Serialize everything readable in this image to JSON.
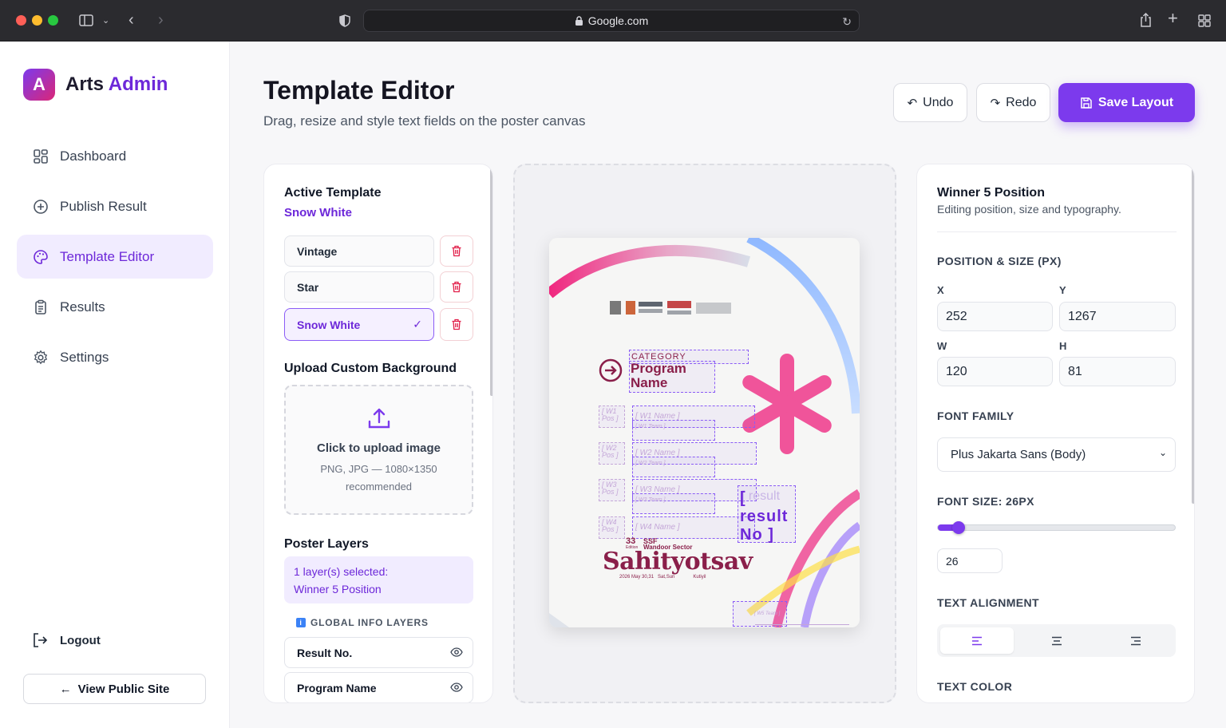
{
  "browser": {
    "url": "Google.com"
  },
  "sidebar": {
    "brand_letter": "A",
    "brand_first": "Arts",
    "brand_second": "Admin",
    "items": [
      {
        "label": "Dashboard",
        "icon": "dashboard-icon"
      },
      {
        "label": "Publish Result",
        "icon": "plus-circle-icon"
      },
      {
        "label": "Template Editor",
        "icon": "palette-icon",
        "active": true
      },
      {
        "label": "Results",
        "icon": "clipboard-icon"
      },
      {
        "label": "Settings",
        "icon": "gear-icon"
      }
    ],
    "logout": "Logout",
    "view_public": "View Public Site"
  },
  "header": {
    "title": "Template Editor",
    "subtitle": "Drag, resize and style text fields on the poster canvas",
    "undo": "Undo",
    "redo": "Redo",
    "save": "Save Layout"
  },
  "left_panel": {
    "active_template_heading": "Active Template",
    "active_template_name": "Snow White",
    "templates": [
      "Vintage",
      "Star",
      "Snow White"
    ],
    "upload_heading": "Upload Custom Background",
    "upload_title": "Click to upload image",
    "upload_hint": "PNG, JPG — 1080×1350 recommended",
    "layers_heading": "Poster Layers",
    "selection_line1": "1 layer(s) selected:",
    "selection_line2": "Winner 5 Position",
    "global_heading": "GLOBAL INFO LAYERS",
    "layers": [
      "Result No.",
      "Program Name"
    ]
  },
  "poster": {
    "category": "CATEGORY",
    "program_line1": "Program",
    "program_line2": "Name",
    "winners": [
      {
        "pos": "[ W1 Pos ]",
        "name": "[ W1 Name ]",
        "team": "[ W1 Team ]"
      },
      {
        "pos": "[ W2 Pos ]",
        "name": "[ W2 Name ]",
        "team": "[ W2 Team ]"
      },
      {
        "pos": "[ W3 Pos ]",
        "name": "[ W3 Name ]",
        "team": "[ W3 Team ]"
      },
      {
        "pos": "[ W4 Pos ]",
        "name": "[ W4 Name ]",
        "team": "[ W4 Team ]"
      }
    ],
    "result_ghost": "[ result",
    "result_line1": "[",
    "result_line2": "result",
    "result_line3": "No ]",
    "edition": "33",
    "edition_sub": "Edition",
    "org": "SSF",
    "sector": "Wandoor Sector",
    "brand": "Sahityotsav",
    "dates": "2026 May 30,31",
    "days": "Sat,Sun",
    "venue": "Kutiyil",
    "w5_team": "[ W5 Team ]"
  },
  "right_panel": {
    "heading": "Winner 5 Position",
    "subheading": "Editing position, size and typography.",
    "pos_size_label": "POSITION & SIZE (PX)",
    "x_label": "X",
    "x": "252",
    "y_label": "Y",
    "y": "1267",
    "w_label": "W",
    "w": "120",
    "h_label": "H",
    "h": "81",
    "font_family_label": "FONT FAMILY",
    "font_family": "Plus Jakarta Sans (Body)",
    "font_size_label": "FONT SIZE: 26PX",
    "font_size_value": "26",
    "font_size_fraction": 0.06,
    "text_alignment_label": "TEXT ALIGNMENT",
    "text_color_label": "TEXT COLOR"
  },
  "colors": {
    "accent": "#7c3aed",
    "accent_text": "#6d28d9",
    "danger": "#e11d48",
    "poster_pink": "#f0549a",
    "poster_maroon": "#8a1f4a"
  }
}
